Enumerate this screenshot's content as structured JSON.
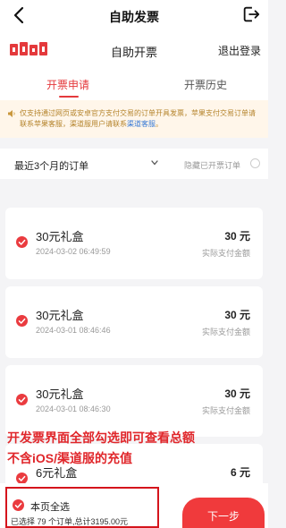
{
  "header": {
    "title": "自助发票"
  },
  "subheader": {
    "title": "自助开票",
    "logout_label": "退出登录"
  },
  "tabs": [
    {
      "label": "开票申请",
      "active": true
    },
    {
      "label": "开票历史",
      "active": false
    }
  ],
  "notice": {
    "text": "仅支持通过网页或安卓官方支付交易的订单开具发票，苹果支付交易订单请联系苹果客服，渠道服用户请联系",
    "link": "渠道客服",
    "end": "。"
  },
  "filter": {
    "period": "最近3个月的订单",
    "hide_label": "隐藏已开票订单"
  },
  "orders": [
    {
      "name": "30元礼盒",
      "date": "2024-03-02 06:49:59",
      "amount": "30 元",
      "amount_label": "实际支付金额"
    },
    {
      "name": "30元礼盒",
      "date": "2024-03-01 08:46:46",
      "amount": "30 元",
      "amount_label": "实际支付金额"
    },
    {
      "name": "30元礼盒",
      "date": "2024-03-01 08:46:30",
      "amount": "30 元",
      "amount_label": "实际支付金额"
    },
    {
      "name": "6元礼盒",
      "amount": "6 元"
    }
  ],
  "overlay": {
    "line1": "开发票界面全部勾选即可查看总额",
    "line2": "不含iOS/渠道服的充值"
  },
  "bottom": {
    "select_all_label": "本页全选",
    "summary": "已选择 79 个订单,总计3195.00元",
    "next_label": "下一步"
  },
  "colors": {
    "accent": "#e4393c",
    "notice_bg": "#fff6ea",
    "link": "#3a7bd5"
  }
}
